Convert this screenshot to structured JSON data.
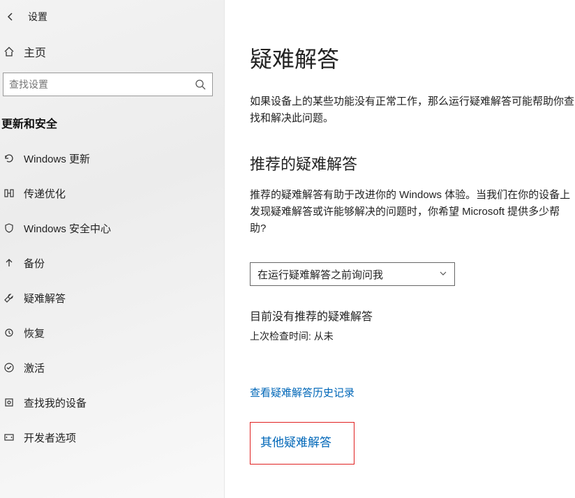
{
  "sidebar": {
    "settings_label": "设置",
    "home_label": "主页",
    "search_placeholder": "查找设置",
    "category_label": "更新和安全",
    "items": [
      {
        "icon": "refresh",
        "label": "Windows 更新"
      },
      {
        "icon": "optimize",
        "label": "传递优化"
      },
      {
        "icon": "shield",
        "label": "Windows 安全中心"
      },
      {
        "icon": "up-arrow",
        "label": "备份"
      },
      {
        "icon": "wrench",
        "label": "疑难解答"
      },
      {
        "icon": "recover",
        "label": "恢复"
      },
      {
        "icon": "check",
        "label": "激活"
      },
      {
        "icon": "device",
        "label": "查找我的设备"
      },
      {
        "icon": "dev",
        "label": "开发者选项"
      }
    ]
  },
  "content": {
    "title": "疑难解答",
    "intro": "如果设备上的某些功能没有正常工作，那么运行疑难解答可能帮助你查找和解决此问题。",
    "section_title": "推荐的疑难解答",
    "section_body": "推荐的疑难解答有助于改进你的 Windows 体验。当我们在你的设备上发现疑难解答或许能够解决的问题时，你希望 Microsoft 提供多少帮助?",
    "select_value": "在运行疑难解答之前询问我",
    "status": "目前没有推荐的疑难解答",
    "substatus": "上次检查时间: 从未",
    "history_link": "查看疑难解答历史记录",
    "other_link": "其他疑难解答"
  }
}
